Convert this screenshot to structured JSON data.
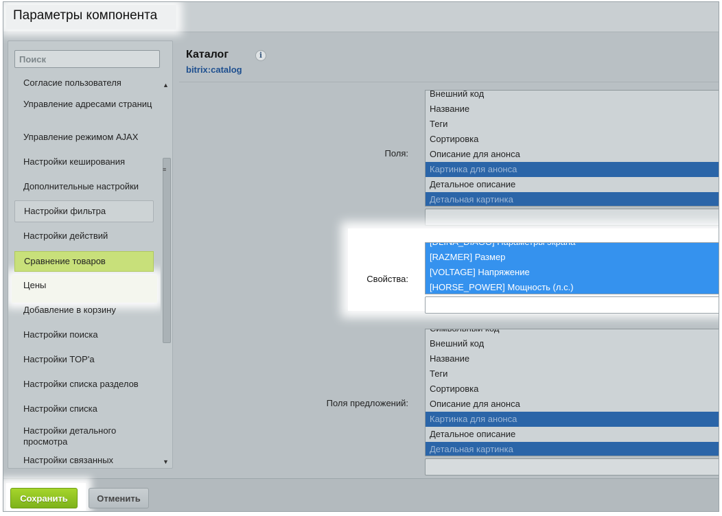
{
  "window": {
    "title": "Параметры компонента"
  },
  "sidebar": {
    "search_placeholder": "Поиск",
    "items": [
      {
        "label": "Согласие пользователя"
      },
      {
        "label": "Управление адресами страниц"
      },
      {
        "label": "Управление режимом AJAX"
      },
      {
        "label": "Настройки кеширования"
      },
      {
        "label": "Дополнительные настройки"
      },
      {
        "label": "Настройки фильтра"
      },
      {
        "label": "Настройки действий"
      },
      {
        "label": "Сравнение товаров"
      },
      {
        "label": "Цены"
      },
      {
        "label": "Добавление в корзину"
      },
      {
        "label": "Настройки поиска"
      },
      {
        "label": "Настройки TOP'а"
      },
      {
        "label": "Настройки списка разделов"
      },
      {
        "label": "Настройки списка"
      },
      {
        "label": "Настройки детального просмотра"
      },
      {
        "label": "Настройки связанных"
      }
    ],
    "active_item": "Сравнение товаров"
  },
  "component": {
    "title": "Каталог",
    "code": "bitrix:catalog",
    "info_icon": "info-icon"
  },
  "fields": {
    "label": "Поля:",
    "options": [
      {
        "label": "Внешний код",
        "selected": false
      },
      {
        "label": "Название",
        "selected": false
      },
      {
        "label": "Теги",
        "selected": false
      },
      {
        "label": "Сортировка",
        "selected": false
      },
      {
        "label": "Описание для анонса",
        "selected": false
      },
      {
        "label": "Картинка для анонса",
        "selected": true
      },
      {
        "label": "Детальное описание",
        "selected": false
      },
      {
        "label": "Детальная картинка",
        "selected": true
      }
    ]
  },
  "properties": {
    "label": "Свойства:",
    "options": [
      {
        "label": "[DLINA_DIAGO] Параметры экрана",
        "selected": true
      },
      {
        "label": "[RAZMER] Размер",
        "selected": true
      },
      {
        "label": "[VOLTAGE] Напряжение",
        "selected": true
      },
      {
        "label": "[HORSE_POWER] Мощность (л.с.)",
        "selected": true
      }
    ]
  },
  "offer_fields": {
    "label": "Поля предложений:",
    "options": [
      {
        "label": "Символьный код",
        "selected": false
      },
      {
        "label": "Внешний код",
        "selected": false
      },
      {
        "label": "Название",
        "selected": false
      },
      {
        "label": "Теги",
        "selected": false
      },
      {
        "label": "Сортировка",
        "selected": false
      },
      {
        "label": "Описание для анонса",
        "selected": false
      },
      {
        "label": "Картинка для анонса",
        "selected": true
      },
      {
        "label": "Детальное описание",
        "selected": false
      },
      {
        "label": "Детальная картинка",
        "selected": true
      }
    ]
  },
  "footer": {
    "save_label": "Сохранить",
    "cancel_label": "Отменить"
  },
  "colors": {
    "accent_green": "#8cc21f",
    "active_item_bg": "#c8e07a",
    "selection_blue": "#3592ee",
    "dim_selection_blue": "#2b65a8",
    "link_blue": "#1e4f8f"
  }
}
